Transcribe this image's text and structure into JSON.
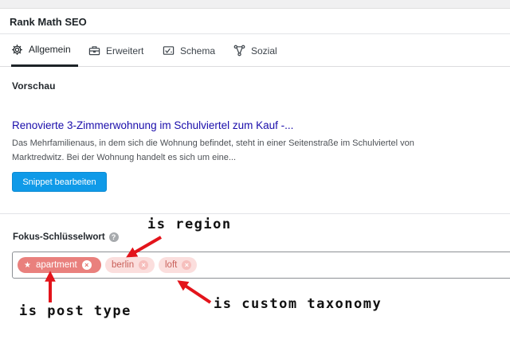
{
  "panel": {
    "title": "Rank Math SEO"
  },
  "tabs": [
    {
      "label": "Allgemein",
      "icon": "gear-icon",
      "active": true
    },
    {
      "label": "Erweitert",
      "icon": "toolbox-icon",
      "active": false
    },
    {
      "label": "Schema",
      "icon": "schema-icon",
      "active": false
    },
    {
      "label": "Sozial",
      "icon": "social-network-icon",
      "active": false
    }
  ],
  "preview": {
    "section_label": "Vorschau",
    "serp_title": "Renovierte 3-Zimmerwohnung im Schulviertel zum Kauf -...",
    "serp_description": "Das Mehrfamilienaus, in dem sich die Wohnung befindet, steht in einer Seitenstraße im Schulviertel von Marktredwitz. Bei der Wohnung handelt es sich um eine...",
    "edit_button_label": "Snippet bearbeiten"
  },
  "focus_keyword": {
    "label": "Fokus-Schlüsselwort",
    "help_icon": "?",
    "tags": [
      {
        "label": "apartment",
        "primary": true
      },
      {
        "label": "berlin",
        "primary": false
      },
      {
        "label": "loft",
        "primary": false
      }
    ],
    "remove_icon": "×",
    "primary_icon": "★"
  },
  "annotations": {
    "region": "is region",
    "post_type": "is post type",
    "custom_taxonomy": "is custom taxonomy"
  },
  "colors": {
    "button_blue": "#0f9ae8",
    "link_blue": "#1a0dab",
    "primary_tag": "#e9807d",
    "secondary_tag": "#fbdedd",
    "arrow_red": "#e3141b"
  }
}
